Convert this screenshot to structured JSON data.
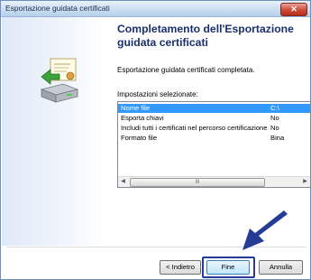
{
  "window": {
    "title": "Esportazione guidata certificati",
    "close_glyph": "✕"
  },
  "main": {
    "heading": "Completamento dell'Esportazione guidata certificati",
    "completed_text": "Esportazione guidata certificati completata.",
    "settings_label": "Impostazioni selezionate:",
    "settings": [
      {
        "name": "Nome file",
        "value": "C:\\",
        "selected": true
      },
      {
        "name": "Esporta chiavi",
        "value": "No",
        "selected": false
      },
      {
        "name": "Includi tutti i certificati nel percorso certificazione",
        "value": "No",
        "selected": false
      },
      {
        "name": "Formato file",
        "value": "Bina",
        "selected": false
      }
    ],
    "scroll_grip": "III"
  },
  "buttons": {
    "back": "< Indietro",
    "finish": "Fine",
    "cancel": "Annulla"
  },
  "icons": {
    "wizard": "certificate-drive-icon",
    "pointer": "arrow-pointer-icon"
  },
  "colors": {
    "heading": "#1a2f6e",
    "selection": "#3399ff",
    "pointer": "#243c96"
  }
}
